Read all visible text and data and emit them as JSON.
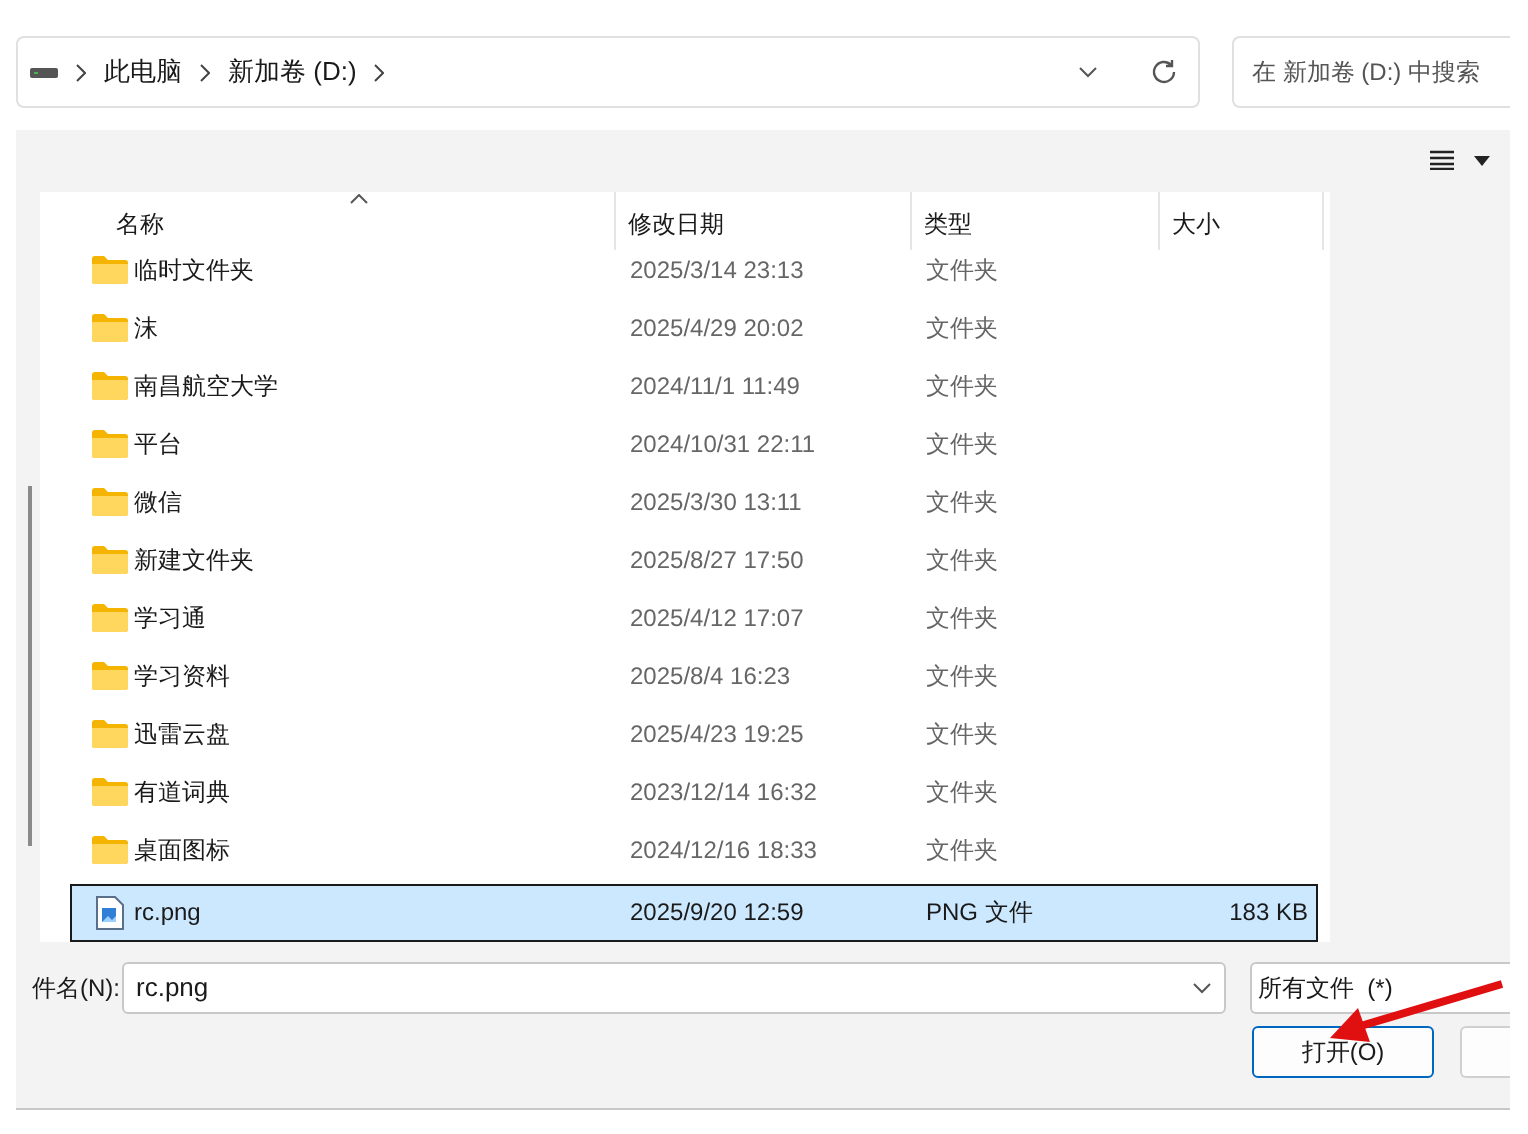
{
  "address_bar": {
    "crumbs": [
      "此电脑",
      "新加卷 (D:)"
    ]
  },
  "search": {
    "placeholder": "在 新加卷 (D:) 中搜索"
  },
  "columns": [
    "名称",
    "修改日期",
    "类型",
    "大小"
  ],
  "rows": [
    {
      "kind": "folder",
      "name": "临时文件夹",
      "date": "2025/3/14 23:13",
      "type": "文件夹",
      "selected": false
    },
    {
      "kind": "folder",
      "name": "沫",
      "date": "2025/4/29 20:02",
      "type": "文件夹",
      "selected": false
    },
    {
      "kind": "folder",
      "name": "南昌航空大学",
      "date": "2024/11/1 11:49",
      "type": "文件夹",
      "selected": false
    },
    {
      "kind": "folder",
      "name": "平台",
      "date": "2024/10/31 22:11",
      "type": "文件夹",
      "selected": false
    },
    {
      "kind": "folder",
      "name": "微信",
      "date": "2025/3/30 13:11",
      "type": "文件夹",
      "selected": false
    },
    {
      "kind": "folder",
      "name": "新建文件夹",
      "date": "2025/8/27 17:50",
      "type": "文件夹",
      "selected": false
    },
    {
      "kind": "folder",
      "name": "学习通",
      "date": "2025/4/12 17:07",
      "type": "文件夹",
      "selected": false
    },
    {
      "kind": "folder",
      "name": "学习资料",
      "date": "2025/8/4 16:23",
      "type": "文件夹",
      "selected": false
    },
    {
      "kind": "folder",
      "name": "迅雷云盘",
      "date": "2025/4/23 19:25",
      "type": "文件夹",
      "selected": false
    },
    {
      "kind": "folder",
      "name": "有道词典",
      "date": "2023/12/14 16:32",
      "type": "文件夹",
      "selected": false
    },
    {
      "kind": "folder",
      "name": "桌面图标",
      "date": "2024/12/16 18:33",
      "type": "文件夹",
      "selected": false
    },
    {
      "kind": "image",
      "name": "rc.png",
      "date": "2025/9/20 12:59",
      "type": "PNG 文件",
      "size": "183 KB",
      "selected": true
    }
  ],
  "filename": {
    "label": "件名(N):",
    "value": "rc.png"
  },
  "filter": {
    "value": "所有文件  (*)"
  },
  "open_button": "打开(O)"
}
